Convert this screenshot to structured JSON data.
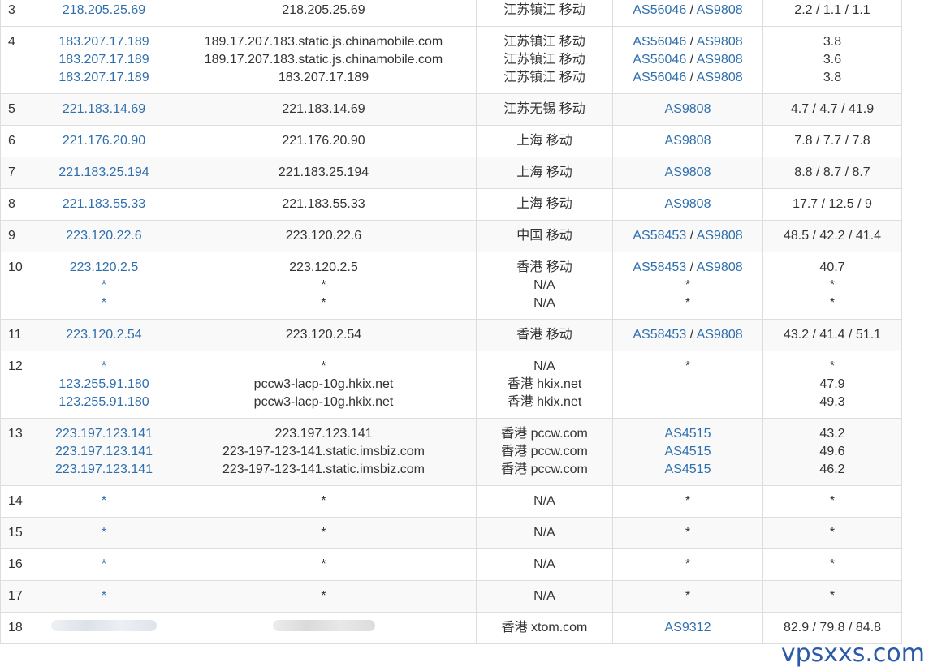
{
  "rows": [
    {
      "hop": "3",
      "alt": false,
      "lines": [
        {
          "ip": "218.205.25.69",
          "host": "218.205.25.69",
          "loc": "江苏镇江 移动",
          "as1": "AS56046",
          "as2": "AS9808",
          "lat": "2.2 / 1.1 / 1.1"
        }
      ]
    },
    {
      "hop": "4",
      "alt": false,
      "lines": [
        {
          "ip": "183.207.17.189",
          "host": "189.17.207.183.static.js.chinamobile.com",
          "loc": "江苏镇江 移动",
          "as1": "AS56046",
          "as2": "AS9808",
          "lat": "3.8"
        },
        {
          "ip": "183.207.17.189",
          "host": "189.17.207.183.static.js.chinamobile.com",
          "loc": "江苏镇江 移动",
          "as1": "AS56046",
          "as2": "AS9808",
          "lat": "3.6"
        },
        {
          "ip": "183.207.17.189",
          "host": "183.207.17.189",
          "loc": "江苏镇江 移动",
          "as1": "AS56046",
          "as2": "AS9808",
          "lat": "3.8"
        }
      ]
    },
    {
      "hop": "5",
      "alt": true,
      "lines": [
        {
          "ip": "221.183.14.69",
          "host": "221.183.14.69",
          "loc": "江苏无锡 移动",
          "as1": "AS9808",
          "as2": "",
          "lat": "4.7 / 4.7 / 41.9"
        }
      ]
    },
    {
      "hop": "6",
      "alt": false,
      "lines": [
        {
          "ip": "221.176.20.90",
          "host": "221.176.20.90",
          "loc": "上海 移动",
          "as1": "AS9808",
          "as2": "",
          "lat": "7.8 / 7.7 / 7.8"
        }
      ]
    },
    {
      "hop": "7",
      "alt": true,
      "lines": [
        {
          "ip": "221.183.25.194",
          "host": "221.183.25.194",
          "loc": "上海 移动",
          "as1": "AS9808",
          "as2": "",
          "lat": "8.8 / 8.7 / 8.7"
        }
      ]
    },
    {
      "hop": "8",
      "alt": false,
      "lines": [
        {
          "ip": "221.183.55.33",
          "host": "221.183.55.33",
          "loc": "上海 移动",
          "as1": "AS9808",
          "as2": "",
          "lat": "17.7 / 12.5 / 9"
        }
      ]
    },
    {
      "hop": "9",
      "alt": true,
      "lines": [
        {
          "ip": "223.120.22.6",
          "host": "223.120.22.6",
          "loc": "中国 移动",
          "as1": "AS58453",
          "as2": "AS9808",
          "lat": "48.5 / 42.2 / 41.4"
        }
      ]
    },
    {
      "hop": "10",
      "alt": false,
      "lines": [
        {
          "ip": "223.120.2.5",
          "host": "223.120.2.5",
          "loc": "香港 移动",
          "as1": "AS58453",
          "as2": "AS9808",
          "lat": "40.7"
        },
        {
          "ip": "*",
          "host": "*",
          "loc": "N/A",
          "as1": "*",
          "as2": "",
          "lat": "*"
        },
        {
          "ip": "*",
          "host": "*",
          "loc": "N/A",
          "as1": "*",
          "as2": "",
          "lat": "*"
        }
      ]
    },
    {
      "hop": "11",
      "alt": true,
      "lines": [
        {
          "ip": "223.120.2.54",
          "host": "223.120.2.54",
          "loc": "香港 移动",
          "as1": "AS58453",
          "as2": "AS9808",
          "lat": "43.2 / 41.4 / 51.1"
        }
      ]
    },
    {
      "hop": "12",
      "alt": false,
      "lines": [
        {
          "ip": "*",
          "host": "*",
          "loc": "N/A",
          "as1": "*",
          "as2": "",
          "lat": "*"
        },
        {
          "ip": "123.255.91.180",
          "host": "pccw3-lacp-10g.hkix.net",
          "loc": "香港 hkix.net",
          "as1": "",
          "as2": "",
          "lat": "47.9"
        },
        {
          "ip": "123.255.91.180",
          "host": "pccw3-lacp-10g.hkix.net",
          "loc": "香港 hkix.net",
          "as1": "",
          "as2": "",
          "lat": "49.3"
        }
      ]
    },
    {
      "hop": "13",
      "alt": true,
      "lines": [
        {
          "ip": "223.197.123.141",
          "host": "223.197.123.141",
          "loc": "香港 pccw.com",
          "as1": "AS4515",
          "as2": "",
          "lat": "43.2"
        },
        {
          "ip": "223.197.123.141",
          "host": "223-197-123-141.static.imsbiz.com",
          "loc": "香港 pccw.com",
          "as1": "AS4515",
          "as2": "",
          "lat": "49.6"
        },
        {
          "ip": "223.197.123.141",
          "host": "223-197-123-141.static.imsbiz.com",
          "loc": "香港 pccw.com",
          "as1": "AS4515",
          "as2": "",
          "lat": "46.2"
        }
      ]
    },
    {
      "hop": "14",
      "alt": false,
      "lines": [
        {
          "ip": "*",
          "host": "*",
          "loc": "N/A",
          "as1": "*",
          "as2": "",
          "lat": "*"
        }
      ]
    },
    {
      "hop": "15",
      "alt": true,
      "lines": [
        {
          "ip": "*",
          "host": "*",
          "loc": "N/A",
          "as1": "*",
          "as2": "",
          "lat": "*"
        }
      ]
    },
    {
      "hop": "16",
      "alt": false,
      "lines": [
        {
          "ip": "*",
          "host": "*",
          "loc": "N/A",
          "as1": "*",
          "as2": "",
          "lat": "*"
        }
      ]
    },
    {
      "hop": "17",
      "alt": true,
      "lines": [
        {
          "ip": "*",
          "host": "*",
          "loc": "N/A",
          "as1": "*",
          "as2": "",
          "lat": "*"
        }
      ]
    },
    {
      "hop": "18",
      "alt": false,
      "redacted": true,
      "lines": [
        {
          "ip": "",
          "host": "",
          "loc": "香港 xtom.com",
          "as1": "AS9312",
          "as2": "",
          "lat": "82.9 / 79.8 / 84.8"
        }
      ]
    }
  ],
  "as_separator": " / ",
  "colors": {
    "link": "#2f6fad",
    "text": "#333333",
    "border": "#dddddd",
    "stripe": "#f9f9f9"
  },
  "watermark": "vpsxxs.com"
}
